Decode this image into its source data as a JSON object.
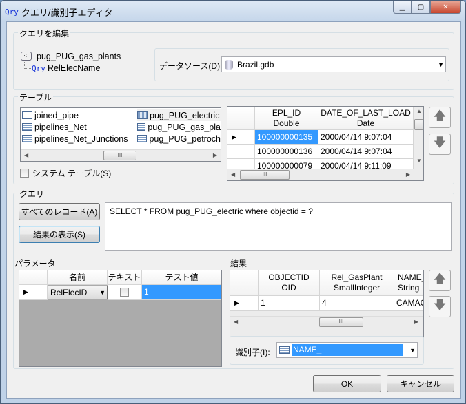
{
  "window": {
    "title": "クエリ/識別子エディタ",
    "icon": "Qry",
    "controls": [
      "minimize",
      "maximize",
      "close"
    ]
  },
  "edit_group": {
    "label": "クエリを編集",
    "tree": {
      "root": "pug_PUG_gas_plants",
      "child_icon": "Qry",
      "child": "RelElecName"
    },
    "datasource_label": "データソース(D):",
    "datasource_value": "Brazil.gdb"
  },
  "table_group": {
    "label": "テーブル",
    "tables": [
      "joined_pipe",
      "pipelines_Net",
      "pipelines_Net_Junctions",
      "pug_PUG_electric",
      "pug_PUG_gas_pla",
      "pug_PUG_petroch"
    ],
    "selected_table": "pug_PUG_electric",
    "system_tables_label": "システム テーブル(S)",
    "system_tables_checked": false,
    "preview": {
      "columns": [
        {
          "name": "EPL_ID",
          "type": "Double"
        },
        {
          "name": "DATE_OF_LAST_LOAD",
          "type": "Date"
        }
      ],
      "rows": [
        [
          "100000000135",
          "2000/04/14 9:07:04"
        ],
        [
          "100000000136",
          "2000/04/14 9:07:04"
        ],
        [
          "100000000079",
          "2000/04/14 9:11:09"
        ]
      ]
    }
  },
  "query_group": {
    "label": "クエリ",
    "all_records_button": "すべてのレコード(A)",
    "show_results_button": "結果の表示(S)",
    "sql": "SELECT * FROM pug_PUG_electric where objectid = ?"
  },
  "params": {
    "label": "パラメータ",
    "columns": [
      "名前",
      "テキスト",
      "テスト値"
    ],
    "rows": [
      {
        "name": "RelElecID",
        "text": false,
        "test_value": "1"
      }
    ]
  },
  "results": {
    "label": "結果",
    "columns": [
      {
        "name": "OBJECTID",
        "type": "OID"
      },
      {
        "name": "Rel_GasPlant",
        "type": "SmallInteger"
      },
      {
        "name": "NAME_",
        "type": "String"
      }
    ],
    "rows": [
      [
        "1",
        "4",
        "CAMAC"
      ]
    ],
    "identifier_label": "識別子(I):",
    "identifier_value": "NAME_"
  },
  "footer": {
    "ok": "OK",
    "cancel": "キャンセル"
  }
}
